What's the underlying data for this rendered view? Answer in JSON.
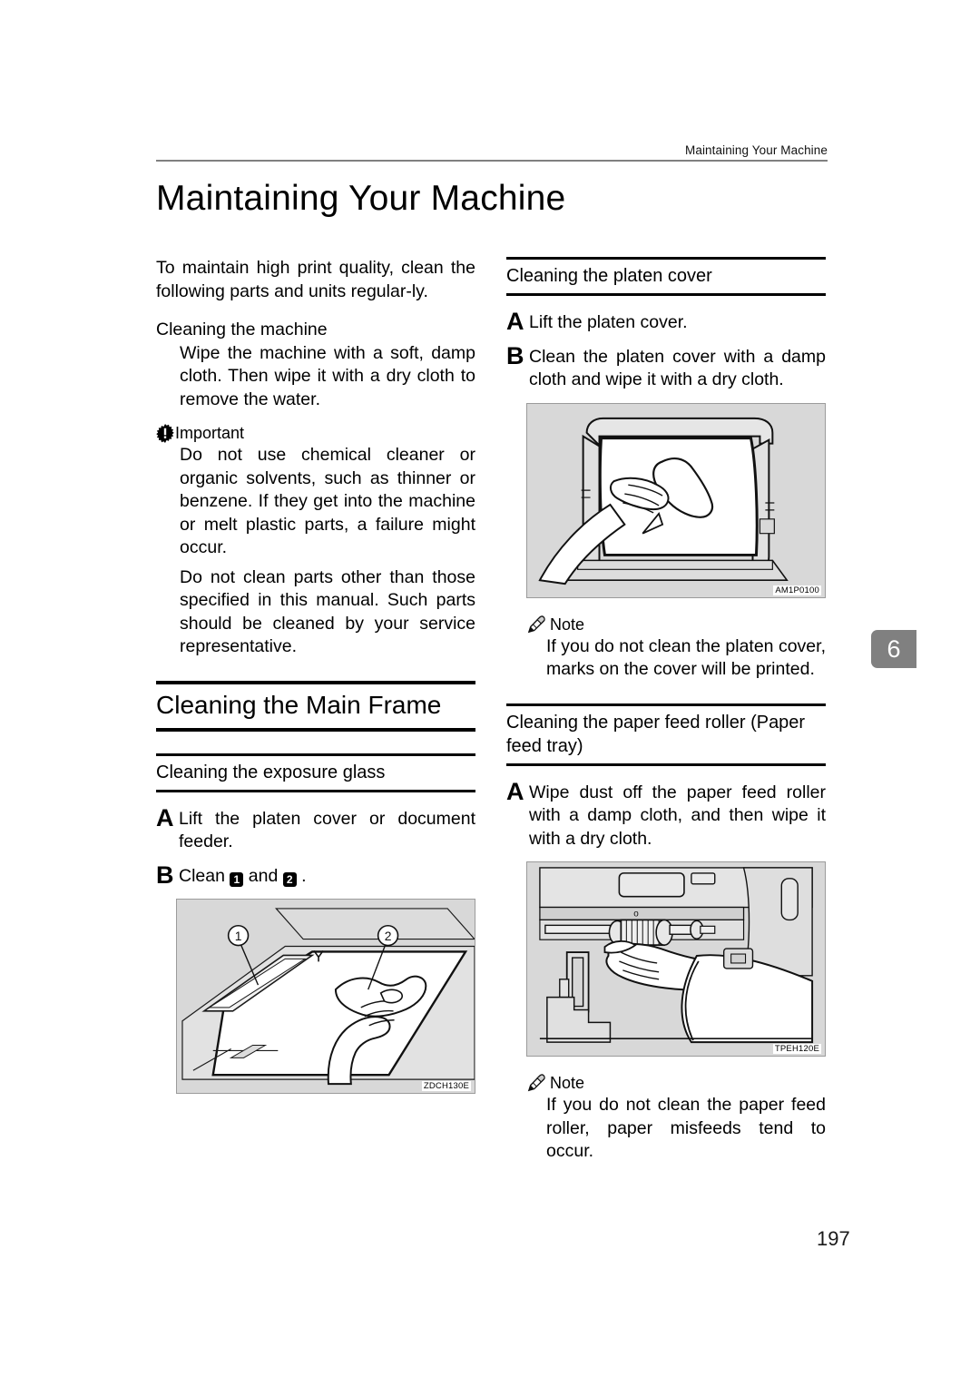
{
  "header": {
    "running_head": "Maintaining Your Machine"
  },
  "chapter_title": "Maintaining Your Machine",
  "chapter_tab": "6",
  "page_number": "197",
  "left_column": {
    "intro": "To maintain high print quality, clean the following parts and units regular-ly.",
    "sub1_heading": "Cleaning the machine",
    "sub1_body": "Wipe the machine with a soft, damp cloth. Then wipe it with a dry cloth to remove the water.",
    "important_label": "Important",
    "important_icon": "burst-exclamation-icon",
    "important_p1": "Do not use chemical cleaner or organic solvents, such as thinner or benzene. If they get into the machine or melt plastic parts, a failure might occur.",
    "important_p2": "Do not clean parts other than those specified in this manual. Such parts should be cleaned by your service representative.",
    "main_frame_heading": "Cleaning the Main Frame",
    "exposure_glass_heading": "Cleaning the exposure glass",
    "steps": [
      {
        "letter": "A",
        "text": "Lift the platen cover or document feeder."
      },
      {
        "letter": "B",
        "text_before": "Clean ",
        "num1": "1",
        "text_mid": " and ",
        "num2": "2",
        "text_after": " ."
      }
    ],
    "figure": {
      "code": "ZDCH130E",
      "callouts": [
        "1",
        "2"
      ],
      "alt": "exposure-glass-cleaning-illustration"
    }
  },
  "right_column": {
    "platen_cover_heading": "Cleaning the platen cover",
    "steps_platen": [
      {
        "letter": "A",
        "text": "Lift the platen cover."
      },
      {
        "letter": "B",
        "text": "Clean the platen cover with a damp cloth and wipe it with a dry cloth."
      }
    ],
    "figure_platen": {
      "code": "AM1P0100",
      "alt": "platen-cover-cleaning-illustration"
    },
    "note1_label": "Note",
    "note1_icon": "pencil-icon",
    "note1_body": "If you do not clean the platen cover, marks on the cover will be printed.",
    "paper_feed_heading": "Cleaning the paper feed roller (Paper feed tray)",
    "steps_feed": [
      {
        "letter": "A",
        "text": "Wipe dust off the paper feed roller with a damp cloth, and then wipe it with a dry cloth."
      }
    ],
    "figure_feed": {
      "code": "TPEH120E",
      "alt": "paper-feed-roller-cleaning-illustration"
    },
    "note2_label": "Note",
    "note2_icon": "pencil-icon",
    "note2_body": "If you do not clean the paper feed roller, paper misfeeds tend to occur."
  }
}
